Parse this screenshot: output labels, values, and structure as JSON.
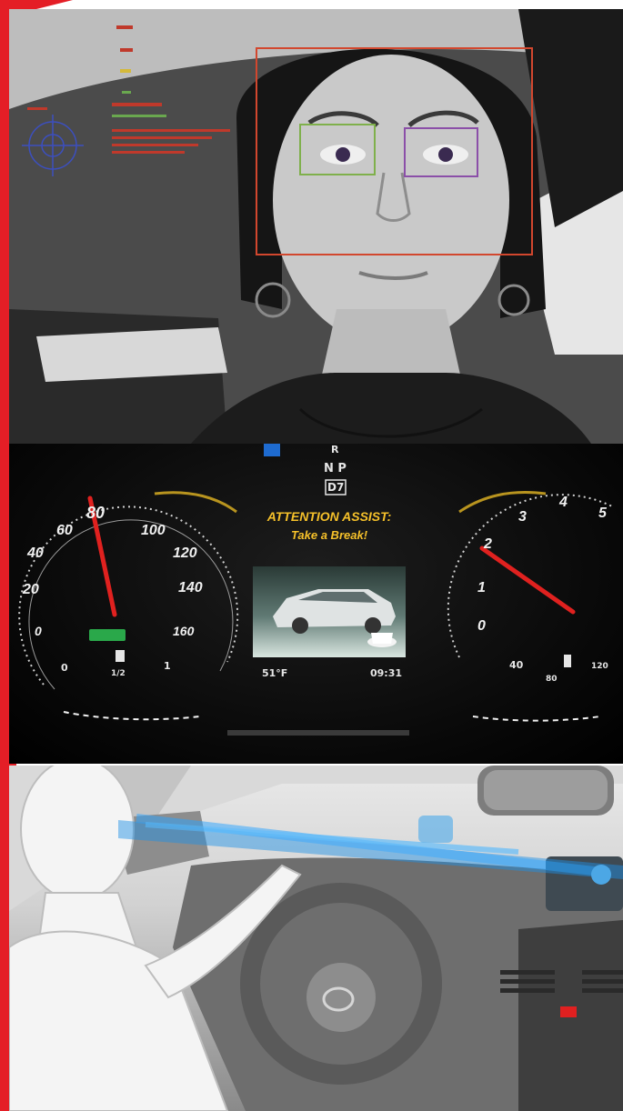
{
  "face_panel": {
    "hud_lines": [
      "",
      "",
      "",
      "",
      "",
      ""
    ],
    "colors": {
      "face_box": "#d2472e",
      "left_eye_box": "#7fb04b",
      "right_eye_box": "#8b4fa8",
      "target": "#3c4fbf"
    }
  },
  "cluster": {
    "gear_top": "R",
    "gear_mid": "N P",
    "gear_box": "D7",
    "alert_title": "ATTENTION ASSIST:",
    "alert_message": "Take a Break!",
    "temperature": "51°F",
    "time": "09:31",
    "speed_labels": [
      "20",
      "40",
      "60",
      "80",
      "100",
      "120",
      "140",
      "160",
      "0"
    ],
    "rpm_labels": [
      "0",
      "1",
      "2",
      "3",
      "4",
      "5"
    ],
    "fuel_labels": [
      "0",
      "1/2",
      "1"
    ],
    "temp_labels": [
      "40",
      "80",
      "120"
    ],
    "colors": {
      "needle": "#e0211f",
      "alert_text": "#f6c12a",
      "indicator": "#2aa84a"
    }
  },
  "cabin_panel": {
    "colors": {
      "gaze_beam": "#1e8fe6",
      "figure": "#f4f4f4"
    }
  }
}
